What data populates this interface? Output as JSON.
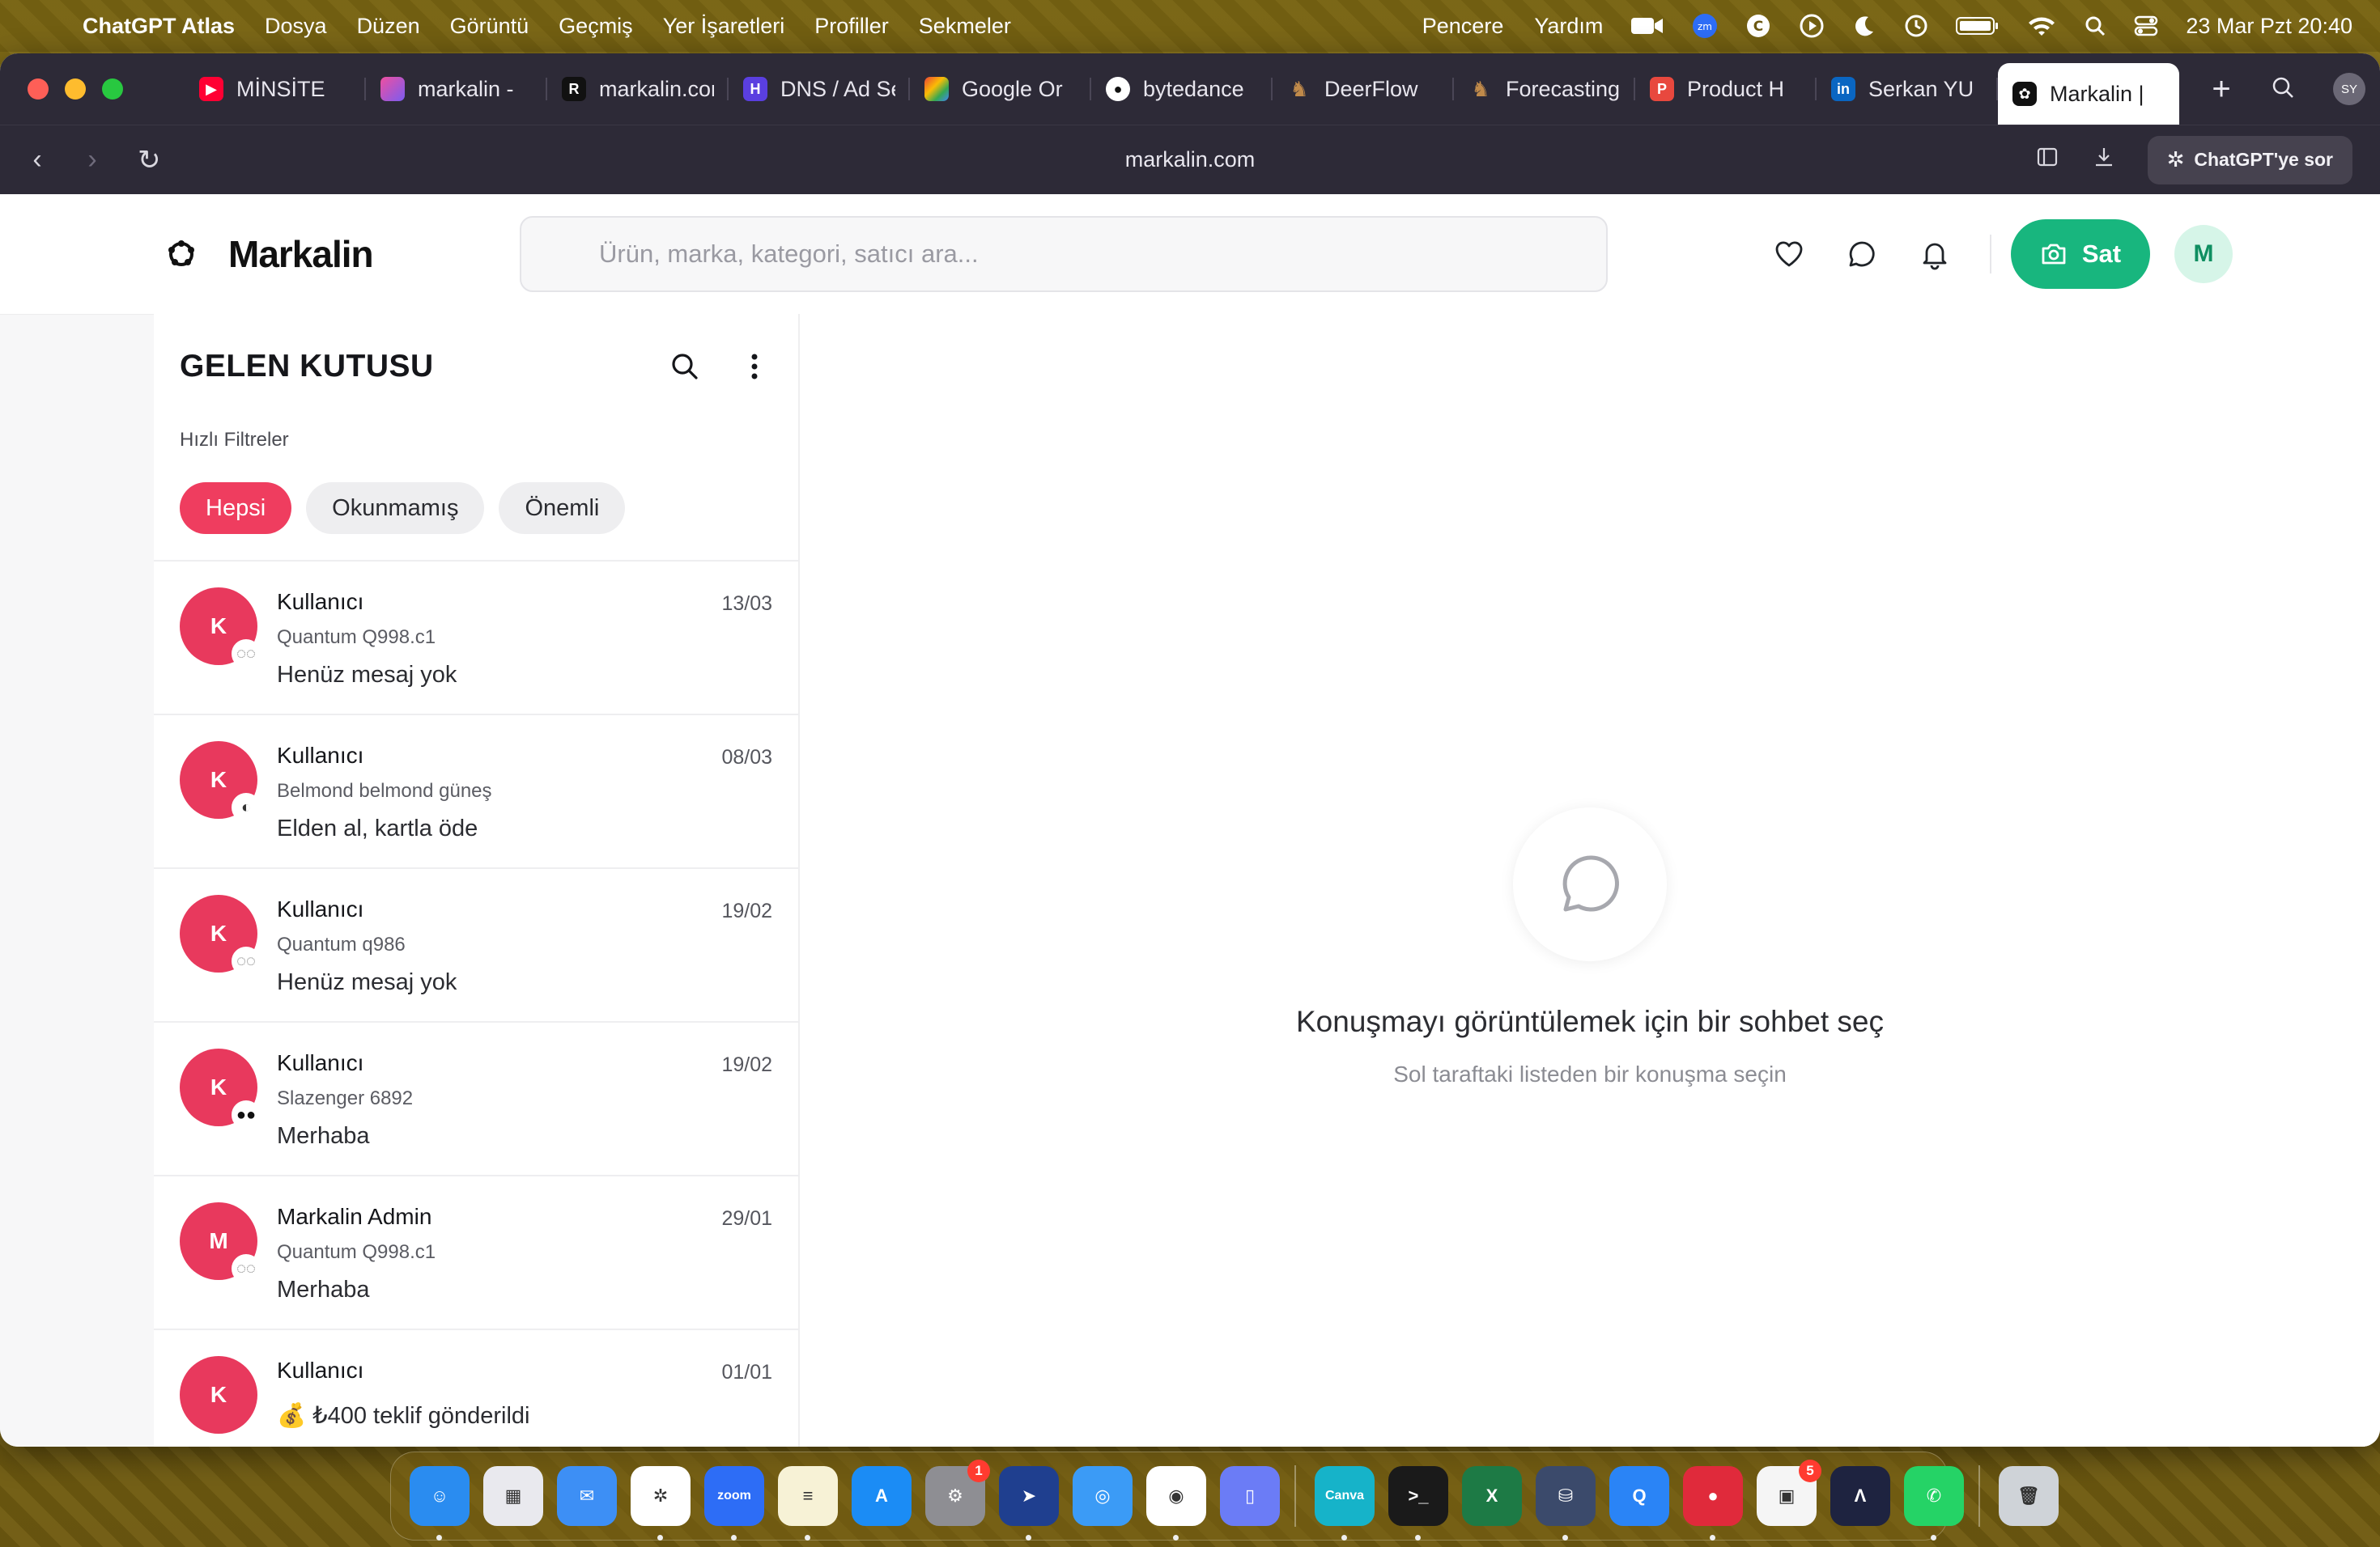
{
  "menubar": {
    "app": "ChatGPT Atlas",
    "items": [
      "Dosya",
      "Düzen",
      "Görüntü",
      "Geçmiş",
      "Yer İşaretleri",
      "Profiller",
      "Sekmeler"
    ],
    "right_items": [
      "Pencere",
      "Yardım"
    ],
    "clock": "23 Mar Pzt  20:40"
  },
  "browser": {
    "tabs": [
      {
        "label": "MİNSİTE",
        "icon": "youtube-icon",
        "color": "#ff0033"
      },
      {
        "label": "markalin - ",
        "icon": "app-icon",
        "color": "#c04fd8"
      },
      {
        "label": "markalin.com",
        "icon": "r-icon",
        "color": "#111111"
      },
      {
        "label": "DNS / Ad Set",
        "icon": "h-icon",
        "color": "#5a3fe0"
      },
      {
        "label": "Google Or",
        "icon": "google-icon",
        "color": "#4285f4"
      },
      {
        "label": "bytedance",
        "icon": "github-icon",
        "color": "#ffffff"
      },
      {
        "label": "DeerFlow",
        "icon": "deer-icon",
        "color": "#b07a3a"
      },
      {
        "label": "Forecasting",
        "icon": "deer-icon",
        "color": "#b07a3a"
      },
      {
        "label": "Product H",
        "icon": "p-icon",
        "color": "#e8483e"
      },
      {
        "label": "Serkan YU",
        "icon": "linkedin-icon",
        "color": "#0a66c2"
      },
      {
        "label": "Markalin | ",
        "icon": "markalin-icon",
        "color": "#111111"
      }
    ],
    "profile_initials": "SY",
    "url": "markalin.com",
    "ask_label": "ChatGPT'ye sor"
  },
  "header": {
    "logo_text": "Markalin",
    "search_placeholder": "Ürün, marka, kategori, satıcı ara...",
    "sell_label": "Sat",
    "avatar_initial": "M",
    "accent": "#18b67e"
  },
  "inbox": {
    "title": "GELEN KUTUSU",
    "quick_filters_label": "Hızlı Filtreler",
    "filters": [
      {
        "label": "Hepsi",
        "active": true
      },
      {
        "label": "Okunmamış",
        "active": false
      },
      {
        "label": "Önemli",
        "active": false
      }
    ],
    "conversations": [
      {
        "initial": "K",
        "name": "Kullanıcı",
        "product": "Quantum Q998.c1",
        "last": "Henüz mesaj yok",
        "date": "13/03",
        "thumb": "glasses-icon"
      },
      {
        "initial": "K",
        "name": "Kullanıcı",
        "product": "Belmond belmond güneş",
        "last": "Elden al, kartla öde",
        "date": "08/03",
        "thumb": "glasses-icon"
      },
      {
        "initial": "K",
        "name": "Kullanıcı",
        "product": "Quantum q986",
        "last": "Henüz mesaj yok",
        "date": "19/02",
        "thumb": "glasses-icon"
      },
      {
        "initial": "K",
        "name": "Kullanıcı",
        "product": "Slazenger 6892",
        "last": "Merhaba",
        "date": "19/02",
        "thumb": "sunglasses-icon"
      },
      {
        "initial": "M",
        "name": "Markalin Admin",
        "product": "Quantum Q998.c1",
        "last": "Merhaba",
        "date": "29/01",
        "thumb": "glasses-icon"
      },
      {
        "initial": "K",
        "name": "Kullanıcı",
        "product": "",
        "last": "💰 ₺400 teklif gönderildi",
        "date": "01/01",
        "thumb": ""
      }
    ],
    "accent": "#ef3d5f"
  },
  "empty_state": {
    "title": "Konuşmayı görüntülemek için bir sohbet seç",
    "subtitle": "Sol taraftaki listeden bir konuşma seçin"
  },
  "dock": {
    "apps": [
      {
        "name": "finder-icon",
        "color": "#2a8cf0",
        "glyph": "☺",
        "running": true
      },
      {
        "name": "launchpad-icon",
        "color": "#e9e9ee",
        "glyph": "▦",
        "running": false
      },
      {
        "name": "mail-icon",
        "color": "#3d8ff5",
        "glyph": "✉",
        "running": false
      },
      {
        "name": "chatgpt-icon",
        "color": "#ffffff",
        "glyph": "✲",
        "running": true
      },
      {
        "name": "zoom-icon",
        "color": "#2d6df6",
        "glyph": "zoom",
        "running": true
      },
      {
        "name": "notes-icon",
        "color": "#f7f2d6",
        "glyph": "≡",
        "running": true
      },
      {
        "name": "appstore-icon",
        "color": "#1b8cf5",
        "glyph": "A",
        "running": false
      },
      {
        "name": "settings-icon",
        "color": "#8e8e93",
        "glyph": "⚙",
        "running": false,
        "badge": "1"
      },
      {
        "name": "telegram-icon",
        "color": "#1f3f8f",
        "glyph": "➤",
        "running": true
      },
      {
        "name": "safari-icon",
        "color": "#3b9bf6",
        "glyph": "◎",
        "running": false
      },
      {
        "name": "chrome-icon",
        "color": "#ffffff",
        "glyph": "◉",
        "running": true
      },
      {
        "name": "simulator-icon",
        "color": "#6b7cf6",
        "glyph": "▯",
        "running": false
      },
      {
        "name": "canva-icon",
        "color": "#16b3c9",
        "glyph": "Canva",
        "running": true
      },
      {
        "name": "terminal-icon",
        "color": "#1a1a1a",
        "glyph": ">_",
        "running": true
      },
      {
        "name": "excel-icon",
        "color": "#1d7a45",
        "glyph": "X",
        "running": false
      },
      {
        "name": "disk-icon",
        "color": "#3b4a6b",
        "glyph": "⛁",
        "running": true
      },
      {
        "name": "quicktime-icon",
        "color": "#2a84f6",
        "glyph": "Q",
        "running": false
      },
      {
        "name": "record-icon",
        "color": "#e02a3b",
        "glyph": "●",
        "running": true
      },
      {
        "name": "office-icon",
        "color": "#f5f5f5",
        "glyph": "▣",
        "running": false,
        "badge": "5"
      },
      {
        "name": "affinity-icon",
        "color": "#1e2340",
        "glyph": "Λ",
        "running": false
      },
      {
        "name": "whatsapp-icon",
        "color": "#25d366",
        "glyph": "✆",
        "running": true
      },
      {
        "name": "trash-icon",
        "color": "#cfd3d8",
        "glyph": "🗑",
        "running": false
      }
    ]
  }
}
